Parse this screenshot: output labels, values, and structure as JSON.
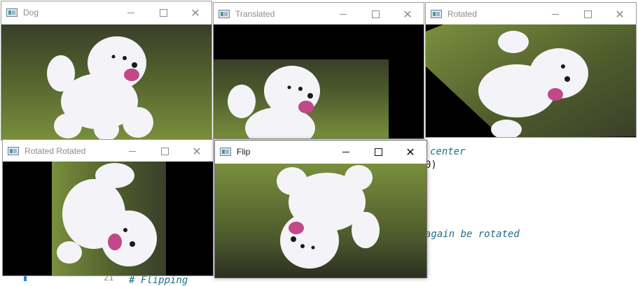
{
  "editor": {
    "lines": [
      {
        "text": "center"
      },
      {
        "text": "0)"
      },
      {
        "text": "again be rotated"
      },
      {
        "text": "# Flipping"
      }
    ],
    "line_number": "21"
  },
  "windows": [
    {
      "title": "Dog",
      "image": "dog-photo"
    },
    {
      "title": "Translated",
      "image": "dog-translated"
    },
    {
      "title": "Rotated",
      "image": "dog-rotated"
    },
    {
      "title": "Rotated Rotated",
      "image": "dog-rotated-twice"
    },
    {
      "title": "Flip",
      "image": "dog-flipped"
    }
  ],
  "controls": {
    "minimize_icon": "minimize-icon",
    "maximize_icon": "maximize-icon",
    "close_icon": "close-icon",
    "close_glyph": "✕"
  },
  "colors": {
    "grass": "#6f8a3c",
    "dog": "#f2f2f6",
    "background": "#000000"
  }
}
